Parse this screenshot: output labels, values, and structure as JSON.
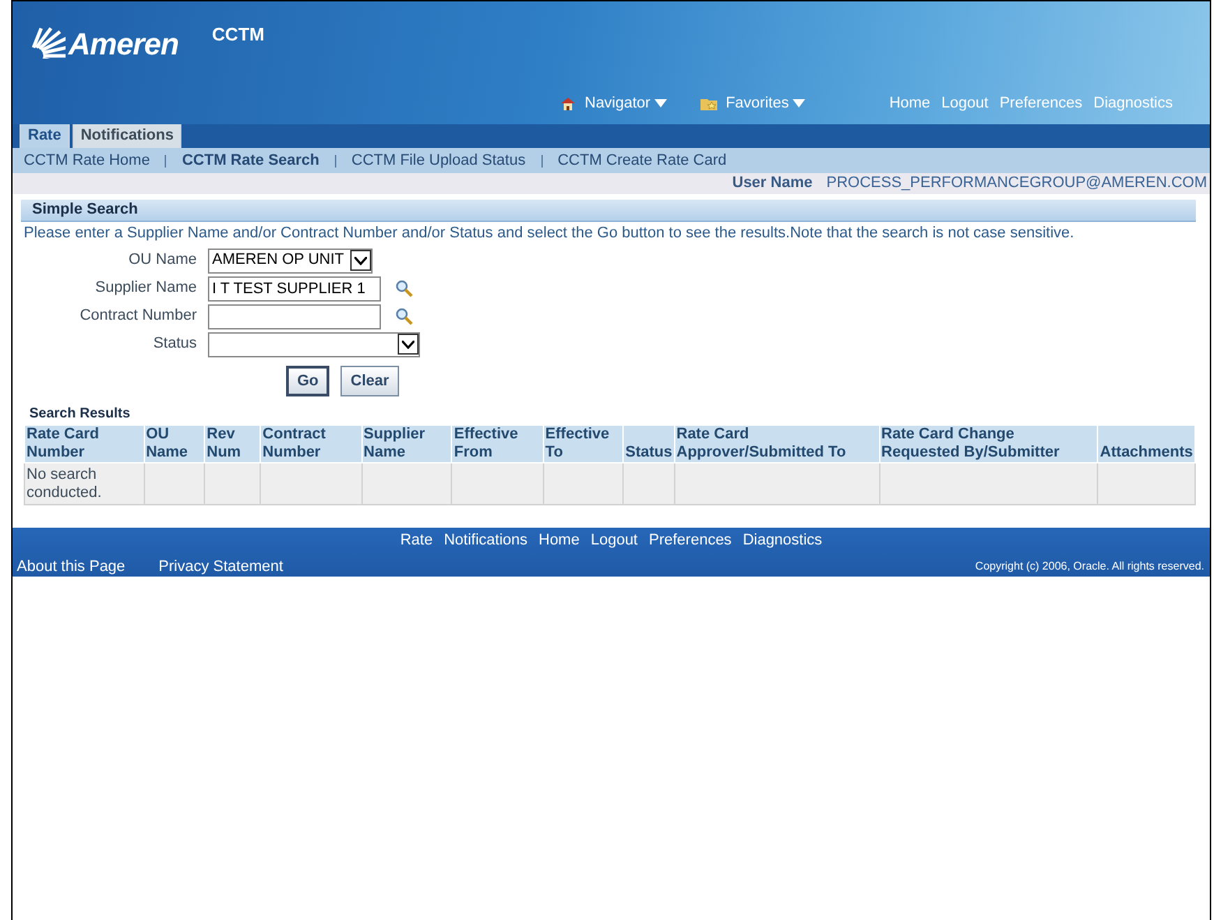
{
  "header": {
    "logo": "Ameren",
    "app_title": "CCTM",
    "menus": [
      {
        "label": "Navigator",
        "kind": "home"
      },
      {
        "label": "Favorites",
        "kind": "folder"
      }
    ],
    "global_links": [
      "Home",
      "Logout",
      "Preferences",
      "Diagnostics"
    ]
  },
  "tabs": [
    {
      "label": "Rate",
      "selected": true
    },
    {
      "label": "Notifications",
      "selected": false
    }
  ],
  "subtabs": [
    {
      "label": "CCTM Rate Home",
      "selected": false
    },
    {
      "label": "CCTM Rate Search",
      "selected": true
    },
    {
      "label": "CCTM File Upload Status",
      "selected": false
    },
    {
      "label": "CCTM Create Rate Card",
      "selected": false
    }
  ],
  "user": {
    "label": "User Name",
    "value": "PROCESS_PERFORMANCEGROUP@AMEREN.COM"
  },
  "search": {
    "title": "Simple Search",
    "instruction": "Please enter a Supplier Name and/or Contract Number and/or Status and select the Go button to see the results.Note that the search is not case sensitive.",
    "fields": [
      {
        "label": "OU Name",
        "kind": "select",
        "value": "AMEREN OP UNIT"
      },
      {
        "label": "Supplier Name",
        "kind": "lov",
        "value": "I T TEST SUPPLIER 1"
      },
      {
        "label": "Contract Number",
        "kind": "lov"
      },
      {
        "label": "Status",
        "kind": "wideselect"
      }
    ],
    "buttons": [
      "Go",
      "Clear"
    ]
  },
  "results": {
    "title": "Search Results",
    "columns": [
      "Rate Card Number",
      "OU Name",
      "Rev Num",
      "Contract Number",
      "Supplier Name",
      "Effective From",
      "Effective To",
      "Status",
      "Rate Card Approver/Submitted To",
      "Rate Card Change Requested By/Submitter",
      "Attachments"
    ],
    "rows": [
      [
        "No search conducted.",
        "",
        "",
        "",
        "",
        "",
        "",
        "",
        "",
        "",
        ""
      ]
    ]
  },
  "footer": {
    "links": [
      "Rate",
      "Notifications",
      "Home",
      "Logout",
      "Preferences",
      "Diagnostics"
    ],
    "bottom_links": [
      "About this Page",
      "Privacy Statement"
    ],
    "copyright": "Copyright (c) 2006, Oracle. All rights reserved."
  }
}
